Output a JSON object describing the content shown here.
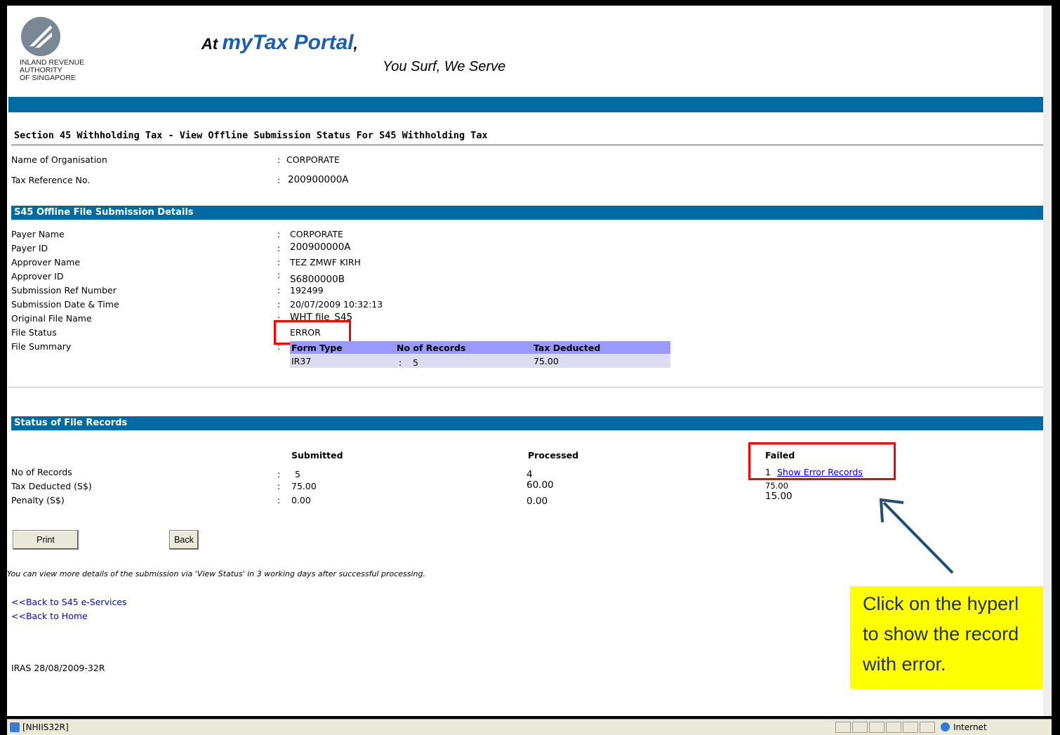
{
  "header": {
    "org_line1": "INLAND REVENUE",
    "org_line2": "AUTHORITY",
    "org_line3": "OF SINGAPORE",
    "slogan_prefix": "At ",
    "slogan_brand": "myTax Portal",
    "slogan_comma": ",",
    "tagline": "You Surf, We Serve"
  },
  "page_title": "Section 45 Withholding Tax - View Offline Submission Status For S45 Withholding Tax",
  "org_info": {
    "name_label": "Name of Organisation",
    "name_value": "CORPORATE",
    "taxref_label": "Tax Reference No.",
    "taxref_value": "200900000A"
  },
  "details_section": {
    "title": "S45 Offline File Submission Details",
    "rows": [
      {
        "label": "Payer Name",
        "value": "CORPORATE"
      },
      {
        "label": "Payer ID",
        "value": "200900000A"
      },
      {
        "label": "Approver Name",
        "value": "TEZ ZMWF KIRH"
      },
      {
        "label": "Approver ID",
        "value": "S6800000B"
      },
      {
        "label": "Submission Ref Number",
        "value": "192499"
      },
      {
        "label": "Submission Date & Time",
        "value": "20/07/2009 10:32:13"
      },
      {
        "label": "Original File Name",
        "value": "WHT file_S45"
      },
      {
        "label": "File Status",
        "value": "ERROR"
      },
      {
        "label": "File Summary",
        "value": ""
      }
    ],
    "summary_table": {
      "headers": [
        "Form Type",
        "No of Records",
        "Tax Deducted"
      ],
      "row": [
        "IR37",
        "5",
        "75.00"
      ]
    }
  },
  "status_section": {
    "title": "Status of File Records",
    "col_submitted": "Submitted",
    "col_processed": "Processed",
    "col_failed": "Failed",
    "rows": [
      {
        "label": "No of Records",
        "submitted": "5",
        "processed": "4",
        "failed": "1"
      },
      {
        "label": "Tax Deducted (S$)",
        "submitted": "75.00",
        "processed": "60.00",
        "failed": "75.00"
      },
      {
        "label": "Penalty (S$)",
        "submitted": "0.00",
        "processed": "0.00",
        "failed": "15.00"
      }
    ],
    "error_link": "Show Error Records"
  },
  "buttons": {
    "print": "Print",
    "back": "Back"
  },
  "note": "You can view more details of the submission via 'View Status' in 3 working days after successful processing.",
  "links": {
    "back_s45": "<<Back to S45 e-Services",
    "back_home": "<<Back to Home"
  },
  "footer_code": "IRAS 28/08/2009-32R",
  "callout": {
    "line1": "Click on the hyperl",
    "line2": "to show the record",
    "line3": "with error."
  },
  "statusbar": {
    "page": "[NHIIS32R]",
    "zone": "Internet"
  },
  "colors": {
    "bar": "#006aa3",
    "highlight": "#ff0000",
    "callout_bg": "#ffff00",
    "arrow": "#1f4e79"
  }
}
